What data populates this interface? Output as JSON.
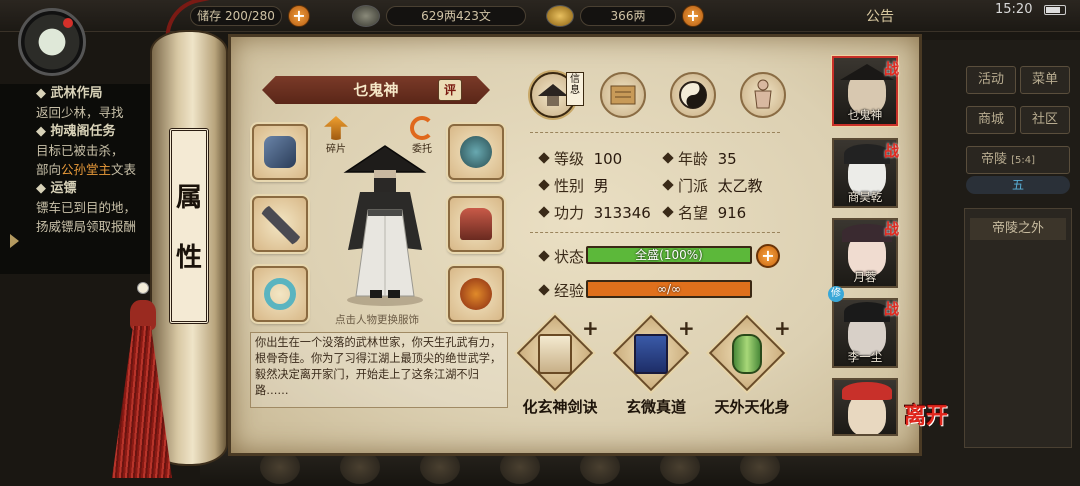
{
  "top_bar": {
    "bag_label": "储存",
    "bag_count": "200/280",
    "copper": "629两423文",
    "silver": "366两",
    "announcement": "公告",
    "time": "15:20"
  },
  "quests": {
    "group1_title": "武林作局",
    "group1_line1": "返回少林，寻找",
    "group2_title": "拘魂阁任务",
    "group2_line1": "目标已被击杀，",
    "group2_line2_a": "部向",
    "group2_line2_hl": "公孙堂主",
    "group2_line2_b": "文表",
    "group3_title": "运镖",
    "group3_line1": "镖车已到目的地，",
    "group3_line2": "扬威镖局领取报酬"
  },
  "right_menu": {
    "activity": "活动",
    "menu": "菜单",
    "mall": "商城",
    "community": "社区",
    "map_name": "帝陵",
    "map_coord": "[5:4]",
    "tab_label": "五",
    "location": "帝陵之外"
  },
  "scroll": {
    "title_char1": "属",
    "title_char2": "性"
  },
  "character": {
    "name": "乜鬼神",
    "evaluate": "评",
    "fragments": "碎片",
    "entrust": "委托",
    "hint": "点击人物更换服饰",
    "bio": "你出生在一个没落的武林世家，你天生孔武有力，根骨奇佳。你为了习得江湖上最顶尖的绝世武学，毅然决定离开家门，开始走上了这条江湖不归路……",
    "info_tag": "信息"
  },
  "stats": {
    "level_label": "等级",
    "level_value": "100",
    "age_label": "年龄",
    "age_value": "35",
    "gender_label": "性别",
    "gender_value": "男",
    "sect_label": "门派",
    "sect_value": "太乙教",
    "power_label": "功力",
    "power_value": "313346",
    "fame_label": "名望",
    "fame_value": "916",
    "status_label": "状态",
    "status_text": "全盛(100%)",
    "status_fill": 1.0,
    "exp_label": "经验",
    "exp_text": "∞/∞",
    "exp_fill": 1.0,
    "status_color": "#5cb83a",
    "exp_color": "#e0701c"
  },
  "skills": [
    {
      "name": "化玄神剑诀",
      "plus": "+"
    },
    {
      "name": "玄微真道",
      "plus": "+"
    },
    {
      "name": "天外天化身",
      "plus": "+"
    }
  ],
  "party": [
    {
      "name": "乜鬼神",
      "badge": "战"
    },
    {
      "name": "商昊乾",
      "badge": "战"
    },
    {
      "name": "月蓉",
      "badge": "战"
    },
    {
      "name": "李一尘",
      "badge": "战",
      "side_badge": "修"
    },
    {
      "name": "",
      "badge": ""
    }
  ],
  "leave_label": "离开"
}
